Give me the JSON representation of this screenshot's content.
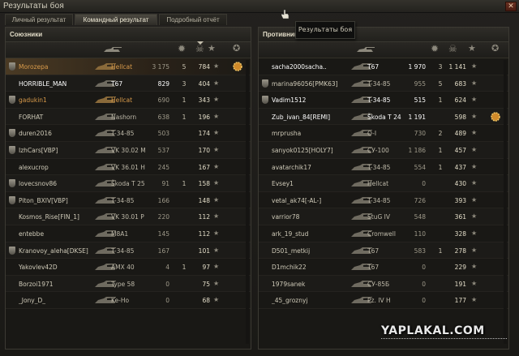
{
  "window": {
    "title": "Результаты боя",
    "close_label": "✕"
  },
  "tabs": [
    {
      "label": "Личный результат",
      "active": false
    },
    {
      "label": "Командный результат",
      "active": true
    },
    {
      "label": "Подробный отчёт",
      "active": false
    }
  ],
  "tooltip": {
    "text": "Результаты боя"
  },
  "allies": {
    "title": "Союзники",
    "rows": [
      {
        "player": "Morozepa",
        "tank": "Hellcat",
        "damage": "3 175",
        "frags": "5",
        "xp": "784",
        "platoon": true,
        "orange": true,
        "self": true,
        "medal": true
      },
      {
        "player": "HORRIBLE_MAN",
        "tank": "T67",
        "damage": "829",
        "frags": "3",
        "xp": "404",
        "platoon": false,
        "white": true
      },
      {
        "player": "gadukin1",
        "tank": "Hellcat",
        "damage": "690",
        "frags": "1",
        "xp": "343",
        "platoon": true,
        "orange": true
      },
      {
        "player": "FORHAT",
        "tank": "Nashorn",
        "damage": "638",
        "frags": "1",
        "xp": "196",
        "platoon": false
      },
      {
        "player": "duren2016",
        "tank": "T-34-85",
        "damage": "503",
        "frags": "",
        "xp": "174",
        "platoon": true
      },
      {
        "player": "IzhCars[VBP]",
        "tank": "VK 30.02 M",
        "damage": "537",
        "frags": "",
        "xp": "170",
        "platoon": true
      },
      {
        "player": "alexucrop",
        "tank": "VK 36.01 H",
        "damage": "245",
        "frags": "",
        "xp": "167",
        "platoon": false
      },
      {
        "player": "lovecsnov86",
        "tank": "Škoda T 25",
        "damage": "91",
        "frags": "1",
        "xp": "158",
        "platoon": true
      },
      {
        "player": "Piton_BXIV[VBP]",
        "tank": "T-34-85",
        "damage": "166",
        "frags": "",
        "xp": "148",
        "platoon": true
      },
      {
        "player": "Kosmos_Rise[FIN_1]",
        "tank": "VK 30.01 P",
        "damage": "220",
        "frags": "",
        "xp": "112",
        "platoon": false
      },
      {
        "player": "entebbe",
        "tank": "M8A1",
        "damage": "145",
        "frags": "",
        "xp": "112",
        "platoon": false
      },
      {
        "player": "Kranovoy_aleha[DKSE]",
        "tank": "T-34-85",
        "damage": "167",
        "frags": "",
        "xp": "101",
        "platoon": true
      },
      {
        "player": "Yakovlev42D",
        "tank": "AMX 40",
        "damage": "4",
        "frags": "1",
        "xp": "97",
        "platoon": false
      },
      {
        "player": "Borzoi1971",
        "tank": "Type 58",
        "damage": "0",
        "frags": "",
        "xp": "75",
        "platoon": false
      },
      {
        "player": "_Jony_D_",
        "tank": "Ke-Ho",
        "damage": "0",
        "frags": "",
        "xp": "68",
        "platoon": false
      }
    ]
  },
  "enemies": {
    "title": "Противники",
    "rows": [
      {
        "player": "sacha2000sacha..",
        "tank": "T67",
        "damage": "1 970",
        "frags": "3",
        "xp": "1 141",
        "platoon": false,
        "white": true
      },
      {
        "player": "marina96056[PMK63]",
        "tank": "T-34-85",
        "damage": "955",
        "frags": "5",
        "xp": "683",
        "platoon": true
      },
      {
        "player": "Vadim1512",
        "tank": "T-34-85",
        "damage": "515",
        "frags": "1",
        "xp": "624",
        "platoon": true,
        "white": true
      },
      {
        "player": "Zub_ivan_84[REMI]",
        "tank": "Škoda T 24",
        "damage": "1 191",
        "frags": "",
        "xp": "598",
        "platoon": false,
        "white": true,
        "medal": true
      },
      {
        "player": "mrprusha",
        "tank": "O-I",
        "damage": "730",
        "frags": "2",
        "xp": "489",
        "platoon": false
      },
      {
        "player": "sanyok0125[HOLY7]",
        "tank": "СУ-100",
        "damage": "1 186",
        "frags": "1",
        "xp": "457",
        "platoon": false
      },
      {
        "player": "avatarchik17",
        "tank": "T-34-85",
        "damage": "554",
        "frags": "1",
        "xp": "437",
        "platoon": false
      },
      {
        "player": "Evsey1",
        "tank": "Hellcat",
        "damage": "0",
        "frags": "",
        "xp": "430",
        "platoon": false
      },
      {
        "player": "vetal_ak74[-AL-]",
        "tank": "T-34-85",
        "damage": "726",
        "frags": "",
        "xp": "393",
        "platoon": false
      },
      {
        "player": "varrior78",
        "tank": "StuG IV",
        "damage": "548",
        "frags": "",
        "xp": "361",
        "platoon": false
      },
      {
        "player": "ark_19_stud",
        "tank": "Cromwell",
        "damage": "110",
        "frags": "",
        "xp": "328",
        "platoon": false
      },
      {
        "player": "D501_metkij",
        "tank": "T67",
        "damage": "583",
        "frags": "1",
        "xp": "278",
        "platoon": false
      },
      {
        "player": "D1mchik22",
        "tank": "T67",
        "damage": "0",
        "frags": "",
        "xp": "229",
        "platoon": false
      },
      {
        "player": "1979sanek",
        "tank": "СУ-85Б",
        "damage": "0",
        "frags": "",
        "xp": "191",
        "platoon": false
      },
      {
        "player": "_45_groznyj",
        "tank": "Pz. IV H",
        "damage": "0",
        "frags": "",
        "xp": "177",
        "platoon": false
      }
    ]
  },
  "watermark": "YAPLAKAL.COM"
}
